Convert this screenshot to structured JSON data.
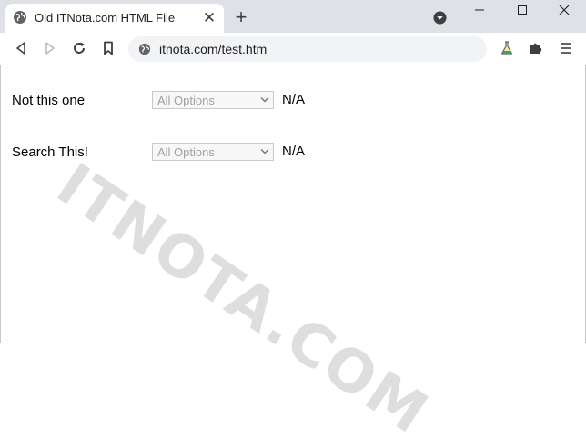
{
  "browser": {
    "tab_title": "Old ITNota.com HTML File",
    "tab_close": "✕",
    "new_tab": "+",
    "url": "itnota.com/test.htm",
    "icons": {
      "tab_favicon": "globe-icon",
      "back": "back-arrow-icon",
      "forward": "forward-arrow-icon",
      "reload": "reload-icon",
      "bookmark": "bookmark-icon",
      "site_info": "globe-icon",
      "labs": "flask-icon",
      "extensions": "puzzle-icon",
      "menu": "menu-icon",
      "profile": "profile-dropdown-icon",
      "minimize": "minimize-icon",
      "maximize": "maximize-icon",
      "close_window": "close-window-icon"
    }
  },
  "page": {
    "rows": [
      {
        "label": "Not this one",
        "select_value": "All Options",
        "suffix": "N/A"
      },
      {
        "label": "Search This!",
        "select_value": "All Options",
        "suffix": "N/A"
      }
    ]
  },
  "watermark": "ITNOTA.COM"
}
